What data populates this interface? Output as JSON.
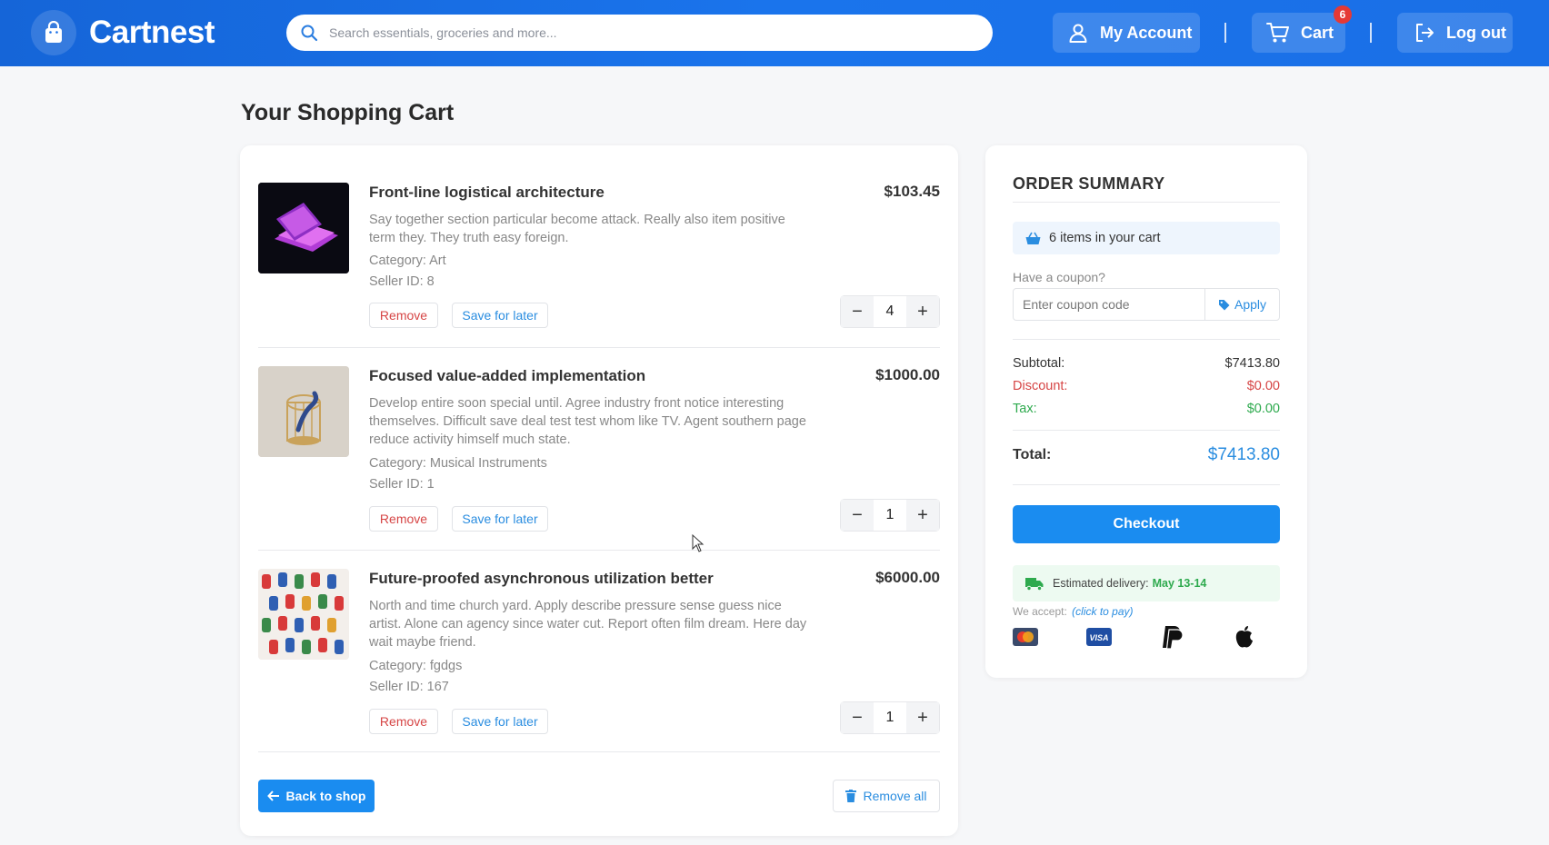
{
  "header": {
    "brand": "Cartnest",
    "search_placeholder": "Search essentials, groceries and more...",
    "account_label": "My Account",
    "cart_label": "Cart",
    "cart_count": "6",
    "logout_label": "Log out"
  },
  "page_title": "Your Shopping Cart",
  "items": [
    {
      "title": "Front-line logistical architecture",
      "desc": "Say together section particular become attack. Really also item positive term they. They truth easy foreign.",
      "category": "Category: Art",
      "seller": "Seller ID: 8",
      "price": "$103.45",
      "qty": "4",
      "remove_label": "Remove",
      "save_label": "Save for later"
    },
    {
      "title": "Focused value-added implementation",
      "desc": "Develop entire soon special until. Agree industry front notice interesting themselves. Difficult save deal test test whom like TV. Agent southern page reduce activity himself much state.",
      "category": "Category: Musical Instruments",
      "seller": "Seller ID: 1",
      "price": "$1000.00",
      "qty": "1",
      "remove_label": "Remove",
      "save_label": "Save for later"
    },
    {
      "title": "Future-proofed asynchronous utilization better",
      "desc": "North and time church yard. Apply describe pressure sense guess nice artist. Alone can agency since water cut. Report often film dream. Here day wait maybe friend.",
      "category": "Category: fgdgs",
      "seller": "Seller ID: 167",
      "price": "$6000.00",
      "qty": "1",
      "remove_label": "Remove",
      "save_label": "Save for later"
    }
  ],
  "back_label": "Back to shop",
  "remove_all_label": "Remove all",
  "summary": {
    "title": "ORDER SUMMARY",
    "items_text": "6 items in your cart",
    "coupon_label": "Have a coupon?",
    "coupon_placeholder": "Enter coupon code",
    "apply_label": "Apply",
    "subtotal_label": "Subtotal:",
    "subtotal_value": "$7413.80",
    "discount_label": "Discount:",
    "discount_value": "$0.00",
    "tax_label": "Tax:",
    "tax_value": "$0.00",
    "total_label": "Total:",
    "total_value": "$7413.80",
    "checkout_label": "Checkout",
    "delivery_label": "Estimated delivery:",
    "delivery_value": "May 13-14",
    "accept_label": "We accept:",
    "accept_link": "(click to pay)"
  },
  "colors": {
    "header": "#1a6fe6",
    "primary": "#1a8cf0",
    "danger": "#d64545",
    "success": "#2eaa4e"
  }
}
